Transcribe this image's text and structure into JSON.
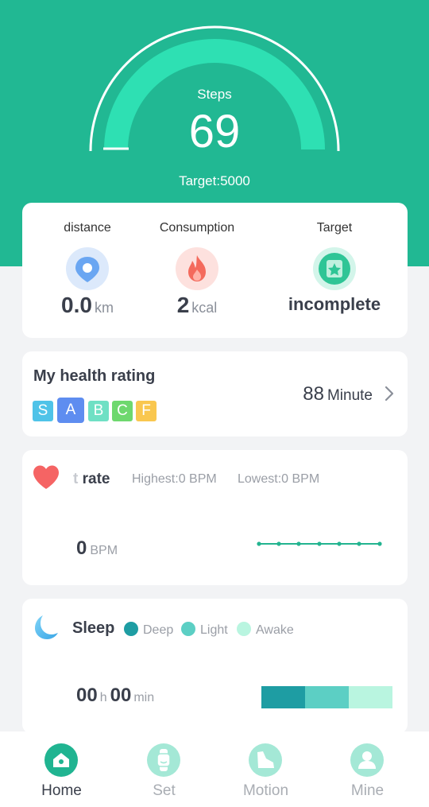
{
  "steps": {
    "label": "Steps",
    "value": "69",
    "target_text": "Target:5000",
    "progress_fraction": 0.014
  },
  "stats": [
    {
      "label": "distance",
      "value": "0.0",
      "unit": "km",
      "icon": "location-pin-icon",
      "color": "#5b9cf0"
    },
    {
      "label": "Consumption",
      "value": "2",
      "unit": "kcal",
      "icon": "flame-icon",
      "color": "#f26a5a"
    },
    {
      "label": "Target",
      "value": "incomplete",
      "icon": "star-badge-icon",
      "color": "#2fc596"
    }
  ],
  "health_rating": {
    "title": "My health rating",
    "grades": [
      {
        "letter": "S",
        "color": "#4fc3e8"
      },
      {
        "letter": "A",
        "color": "#5e8df0",
        "selected": true
      },
      {
        "letter": "B",
        "color": "#6fe0c4"
      },
      {
        "letter": "C",
        "color": "#6ed86e"
      },
      {
        "letter": "F",
        "color": "#f9c74f"
      }
    ],
    "value": "88",
    "unit": "Minute"
  },
  "heart_rate": {
    "title_faded": "t",
    "title": "rate",
    "highest": "Highest:0  BPM",
    "lowest": "Lowest:0  BPM",
    "value": "0",
    "unit": "BPM"
  },
  "sleep": {
    "title": "Sleep",
    "legend": [
      {
        "label": "Deep",
        "color": "#1e9da3"
      },
      {
        "label": "Light",
        "color": "#5ccfc4"
      },
      {
        "label": "Awake",
        "color": "#b9f5e0"
      }
    ],
    "hours": "00",
    "hours_unit": "h",
    "minutes": "00",
    "minutes_unit": "min"
  },
  "tabs": [
    {
      "label": "Home",
      "icon": "home-icon",
      "active": true
    },
    {
      "label": "Set",
      "icon": "watch-icon"
    },
    {
      "label": "Motion",
      "icon": "shoe-icon"
    },
    {
      "label": "Mine",
      "icon": "person-icon"
    }
  ],
  "colors": {
    "brand": "#21b893",
    "arc": "#2ee0b3",
    "text_dark": "#3a3f4b",
    "text_muted": "#9a9ea6"
  }
}
